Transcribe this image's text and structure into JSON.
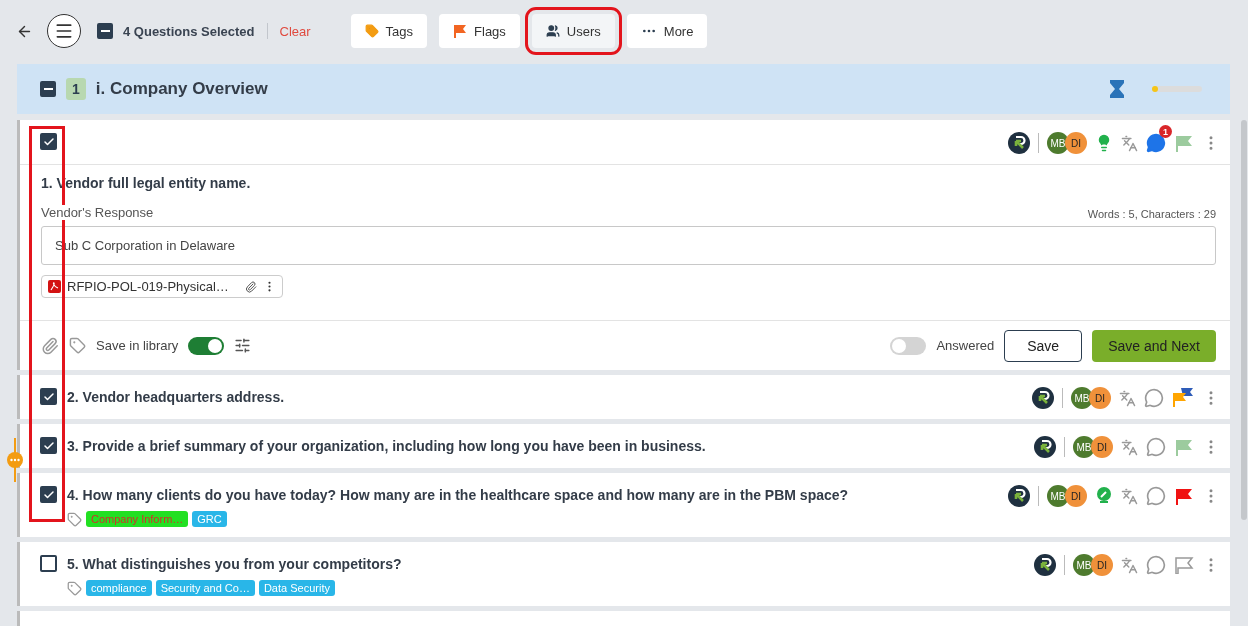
{
  "toolbar": {
    "indeterminate": true,
    "selected_count": "4 Questions Selected",
    "clear": "Clear",
    "actions": [
      {
        "kind": "tags",
        "label": "Tags",
        "highlighted": false
      },
      {
        "kind": "flags",
        "label": "Flags",
        "highlighted": false
      },
      {
        "kind": "users",
        "label": "Users",
        "highlighted": true
      },
      {
        "kind": "more",
        "label": "More",
        "highlighted": false
      }
    ]
  },
  "section": {
    "indeterminate": true,
    "number": "1",
    "title": "i. Company Overview",
    "progress": {
      "level": 0.1
    }
  },
  "questions": [
    {
      "checked": true,
      "expanded": true,
      "text": "1. Vendor full legal entity name.",
      "avatars": [
        "MB",
        "DI"
      ],
      "bulb": {
        "kind": "solid"
      },
      "comments": "1",
      "flag": {
        "kind": "pale"
      },
      "response": {
        "label": "Vendor's Response",
        "counts": "Words : 5, Characters : 29",
        "value": "Sub C Corporation in Delaware",
        "attachment": "RFPIO-POL-019-Physical…",
        "save_in_library_label": "Save in library",
        "save_in_library": true,
        "answered_label": "Answered",
        "answered": false,
        "buttons": [
          "Save",
          "Save and Next"
        ]
      }
    },
    {
      "checked": true,
      "expanded": false,
      "text": "2. Vendor headquarters address.",
      "avatars": [
        "MB",
        "DI"
      ],
      "flag": {
        "kind": "double"
      }
    },
    {
      "checked": true,
      "expanded": false,
      "marker": true,
      "text": "3. Provide a brief summary of your organization, including how long you have been in business.",
      "avatars": [
        "MB",
        "DI"
      ],
      "flag": {
        "kind": "pale"
      }
    },
    {
      "checked": true,
      "expanded": false,
      "text": "4. How many clients do you have today? How many are in the healthcare space and how many are in the PBM space?",
      "avatars": [
        "MB",
        "DI"
      ],
      "bulb": {
        "kind": "edit"
      },
      "flag": {
        "kind": "red"
      },
      "tags": [
        {
          "label": "Company Inform…",
          "color": "#22e022"
        },
        {
          "label": "GRC",
          "color": "#29b6e8"
        }
      ]
    },
    {
      "checked": false,
      "expanded": false,
      "text": "5. What distinguishes you from your competitors?",
      "avatars": [
        "MB",
        "DI"
      ],
      "flag": {
        "kind": "outline"
      },
      "tags": [
        {
          "label": "compliance",
          "color": "#29b6e8"
        },
        {
          "label": "Security and Co…",
          "color": "#29b6e8"
        },
        {
          "label": "Data Security",
          "color": "#29b6e8"
        }
      ]
    }
  ]
}
